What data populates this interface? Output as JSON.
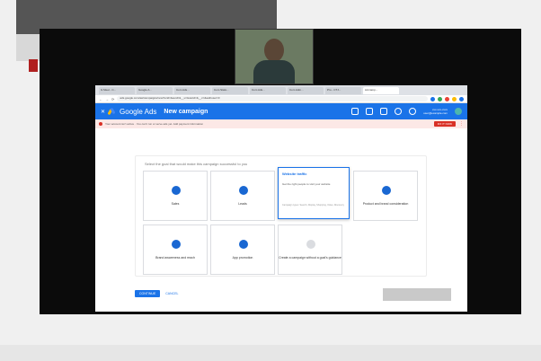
{
  "browser": {
    "tabs": [
      {
        "label": "G Meet - C..."
      },
      {
        "label": "Google A..."
      },
      {
        "label": "Com Ads..."
      },
      {
        "label": "Com Stats..."
      },
      {
        "label": "Com Ads..."
      },
      {
        "label": "Com Adm..."
      },
      {
        "label": "Pro - CTJ..."
      },
      {
        "label": "Ad camp..."
      }
    ],
    "url": "ads.google.com/aw/campaigns/new?ocid=&euid=&__u=&uscid=&__c=&authuser=0"
  },
  "ads": {
    "brand": "Google Ads",
    "page_title": "New campaign",
    "account_line1": "xxx-xxx-xxxx",
    "account_line2": "user@example.com"
  },
  "alert": {
    "text": "Your account isn't active · You can't run or serve ads yet. Add payment information",
    "action": "FIX IT NOW"
  },
  "goal_heading": "Select the goal that would make this campaign successful to you",
  "goals": {
    "sales": "Sales",
    "leads": "Leads",
    "website_traffic": {
      "title": "Website traffic",
      "desc": "Get the right people to visit your website",
      "meta": "Campaign types: Search, Display, Shopping, Video, Discovery"
    },
    "product_brand": "Product and brand consideration",
    "brand_awareness": "Brand awareness and reach",
    "app_promotion": "App promotion",
    "no_goal": "Create a campaign without a goal's guidance"
  },
  "footer": {
    "continue": "CONTINUE",
    "cancel": "CANCEL"
  },
  "colors": {
    "accent": "#1a73e8",
    "alert": "#d93025"
  }
}
